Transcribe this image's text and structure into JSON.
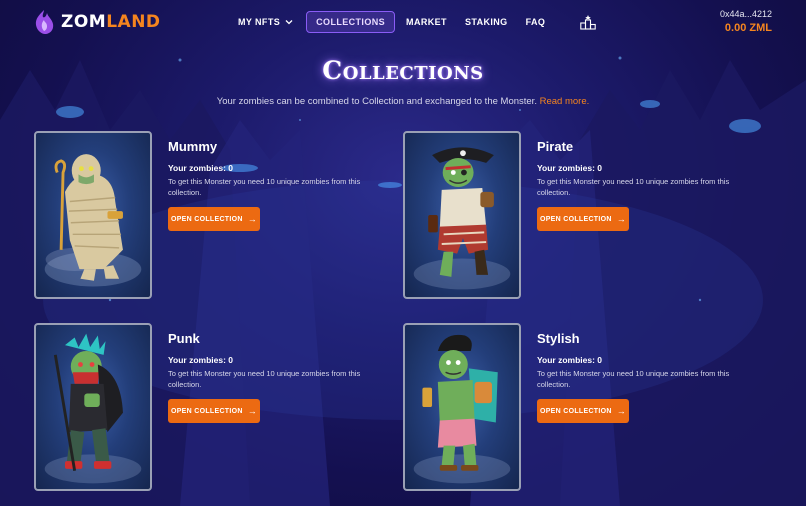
{
  "brand": {
    "logo_part1": "ZOM",
    "logo_part2": "LAND",
    "accent": "#f5851f",
    "nav_active": "#8a5cf6"
  },
  "nav": {
    "items": [
      {
        "label": "MY NFTS",
        "has_dropdown": true
      },
      {
        "label": "COLLECTIONS",
        "active": true
      },
      {
        "label": "MARKET"
      },
      {
        "label": "STAKING"
      },
      {
        "label": "FAQ"
      }
    ],
    "leaderboard_icon": "podium-icon"
  },
  "wallet": {
    "address": "0x44a...4212",
    "balance": "0.00 ZML"
  },
  "page": {
    "title": "Collections",
    "subtitle": "Your zombies can be combined to Collection and exchanged to the Monster.",
    "subtitle_link": "Read more."
  },
  "collections": [
    {
      "name": "Mummy",
      "count_label": "Your zombies: 0",
      "description": "To get this Monster you need 10 unique zombies from this collection.",
      "button_label": "OPEN COLLECTION",
      "icon": "arrow-right-icon"
    },
    {
      "name": "Pirate",
      "count_label": "Your zombies: 0",
      "description": "To get this Monster you need 10 unique zombies from this collection.",
      "button_label": "OPEN COLLECTION",
      "icon": "arrow-right-icon"
    },
    {
      "name": "Punk",
      "count_label": "Your zombies: 0",
      "description": "To get this Monster you need 10 unique zombies from this collection.",
      "button_label": "OPEN COLLECTION",
      "icon": "arrow-right-icon"
    },
    {
      "name": "Stylish",
      "count_label": "Your zombies: 0",
      "description": "To get this Monster you need 10 unique zombies from this collection.",
      "button_label": "OPEN COLLECTION",
      "icon": "arrow-right-icon"
    }
  ]
}
